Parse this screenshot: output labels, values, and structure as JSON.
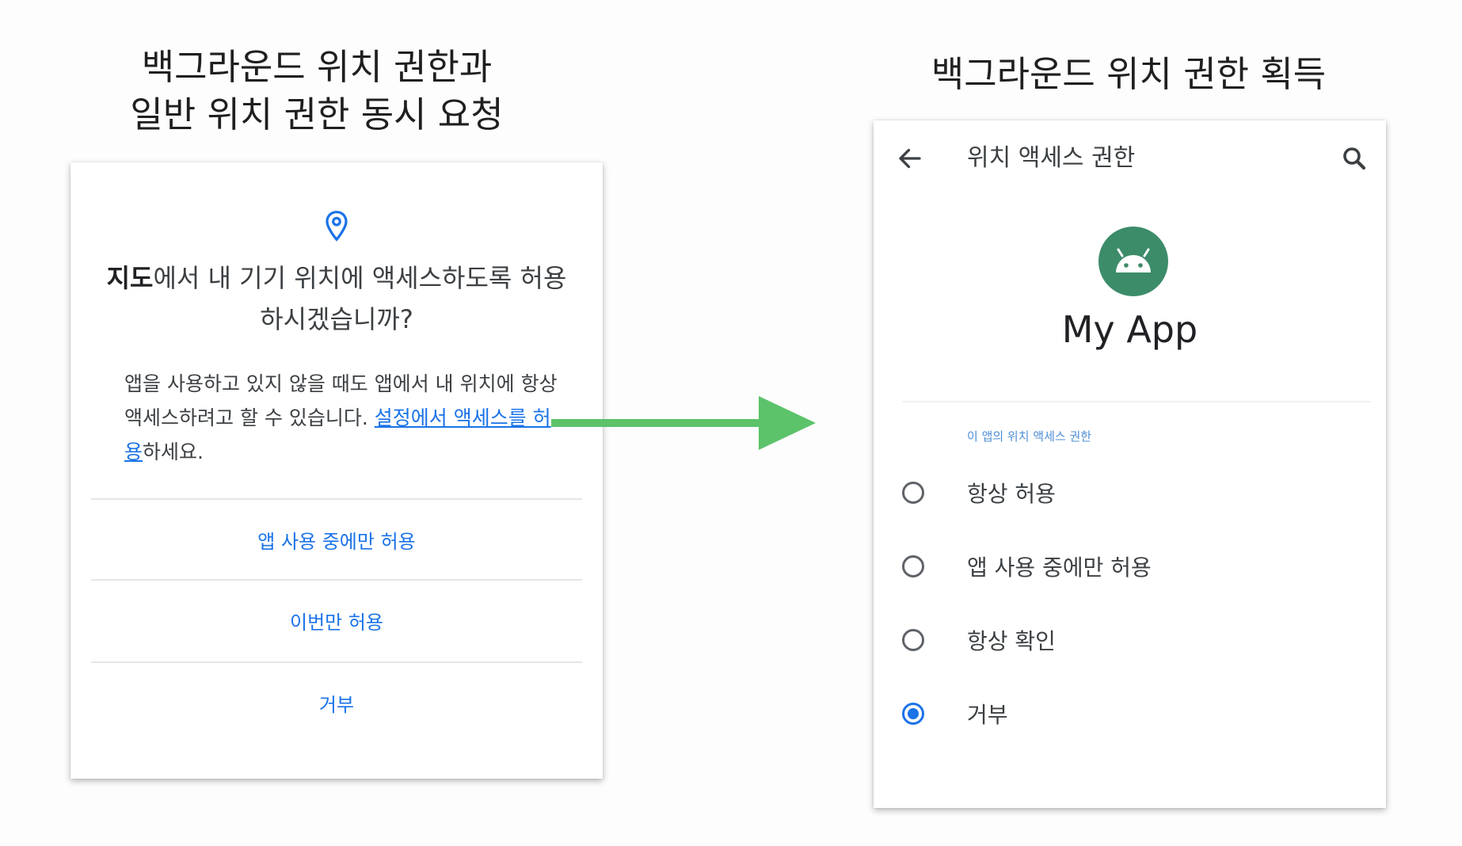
{
  "headings": {
    "left_line1": "백그라운드 위치 권한과",
    "left_line2": "일반 위치 권한 동시 요청",
    "right": "백그라운드 위치 권한 획득"
  },
  "dialog": {
    "icon": "location-pin-icon",
    "title_app": "지도",
    "title_rest": "에서 내 기기 위치에 액세스하도록 허용하시겠습니까?",
    "body_text": "앱을 사용하고 있지 않을 때도 앱에서 내 위치에 항상 액세스하려고 할 수 있습니다. ",
    "body_link": "설정에서 액세스를 허용",
    "body_tail": "하세요.",
    "buttons": {
      "while_using": "앱 사용 중에만 허용",
      "only_this_time": "이번만 허용",
      "deny": "거부"
    }
  },
  "settings": {
    "back_icon": "arrow-left-icon",
    "title": "위치 액세스 권한",
    "search_icon": "search-icon",
    "app_icon": "android-icon",
    "app_name": "My App",
    "section_label": "이 앱의 위치 액세스 권한",
    "options": [
      {
        "label": "항상 허용",
        "checked": false
      },
      {
        "label": "앱 사용 중에만 허용",
        "checked": false
      },
      {
        "label": "항상 확인",
        "checked": false
      },
      {
        "label": "거부",
        "checked": true
      }
    ]
  },
  "colors": {
    "accent": "#1a73e8",
    "arrow": "#5cc36a",
    "app_icon_bg": "#3c8c6a"
  }
}
